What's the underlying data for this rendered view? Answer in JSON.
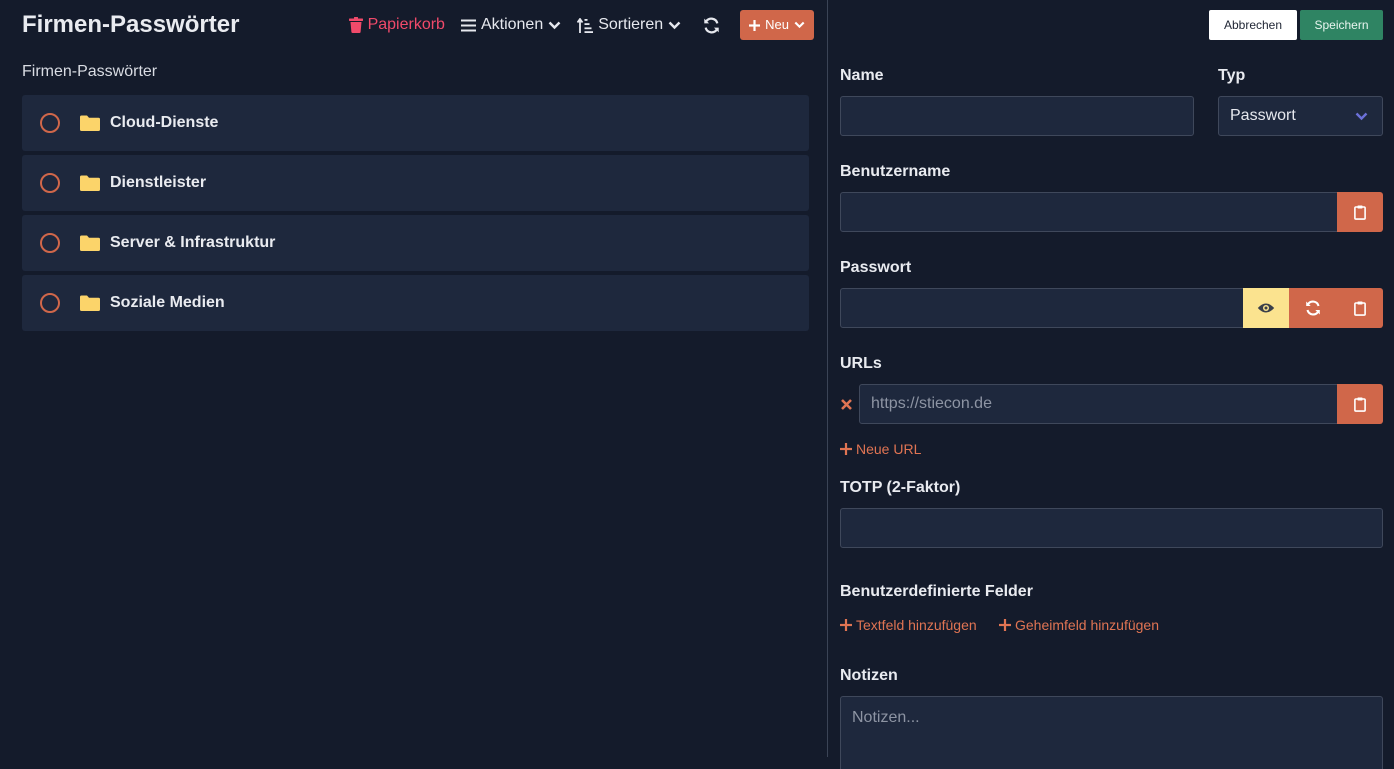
{
  "left": {
    "title": "Firmen-Passwörter",
    "breadcrumb": "Firmen-Passwörter",
    "toolbar": {
      "trash_label": "Papierkorb",
      "actions_label": "Aktionen",
      "sort_label": "Sortieren",
      "new_label": "Neu"
    },
    "folders": [
      {
        "label": "Cloud-Dienste"
      },
      {
        "label": "Dienstleister"
      },
      {
        "label": "Server & Infrastruktur"
      },
      {
        "label": "Soziale Medien"
      }
    ]
  },
  "form": {
    "cancel_label": "Abbrechen",
    "save_label": "Speichern",
    "name_label": "Name",
    "name_value": "",
    "type_label": "Typ",
    "type_value": "Passwort",
    "username_label": "Benutzername",
    "username_value": "",
    "password_label": "Passwort",
    "password_value": "",
    "urls_label": "URLs",
    "url_placeholder": "https://stiecon.de",
    "add_url_label": "Neue URL",
    "totp_label": "TOTP (2-Faktor)",
    "totp_value": "",
    "custom_fields_label": "Benutzerdefinierte Felder",
    "add_textfield_label": "Textfeld hinzufügen",
    "add_secretfield_label": "Geheimfeld hinzufügen",
    "notes_label": "Notizen",
    "notes_placeholder": "Notizen..."
  },
  "colors": {
    "background": "#141b2b",
    "panel": "#1e283d",
    "accent_orange": "#d0674a",
    "trash_red": "#f04a6a",
    "save_green": "#2f8463",
    "eye_yellow": "#fbe38f",
    "folder_yellow": "#fcd46a"
  },
  "icons": {
    "trash": "trash-icon",
    "actions": "hamburger-icon",
    "sort": "sort-icon",
    "refresh": "refresh-icon",
    "new": "plus-icon",
    "folder": "folder-icon",
    "clipboard": "clipboard-icon",
    "eye": "eye-icon",
    "generate": "refresh-icon",
    "remove": "close-icon"
  }
}
